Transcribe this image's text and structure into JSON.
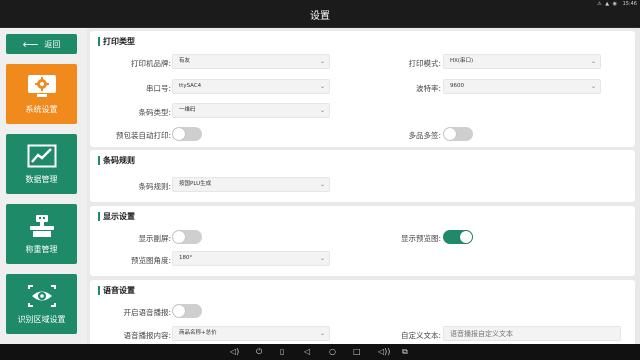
{
  "status_bar": {
    "icons": "⚠ ▲ ◉",
    "time": "15:46"
  },
  "title": "设置",
  "sidebar": {
    "back_label": "返回",
    "items": [
      {
        "label": "系统设置",
        "icon": "gear-icon",
        "active": true
      },
      {
        "label": "数据管理",
        "icon": "line-chart-icon",
        "active": false
      },
      {
        "label": "称重管理",
        "icon": "scale-icon",
        "active": false
      },
      {
        "label": "识别区域设置",
        "icon": "eye-icon",
        "active": false
      }
    ]
  },
  "sections": {
    "print_type": {
      "title": "打印类型",
      "brand_label": "打印机品牌:",
      "brand_value": "有友",
      "mode_label": "打印模式:",
      "mode_value": "HX(串口)",
      "port_label": "串口号:",
      "port_value": "ttySAC4",
      "baud_label": "波特率:",
      "baud_value": "9600",
      "barcode_label": "条码类型:",
      "barcode_value": "一维码",
      "auto_print_label": "预包装自动打印:",
      "auto_print_on": false,
      "multi_label": "多品多签:",
      "multi_on": false
    },
    "barcode_rules": {
      "title": "条码规则",
      "rule_label": "条码规则:",
      "rule_value": "按国PLU生成"
    },
    "display": {
      "title": "显示设置",
      "sub_screen_label": "显示副屏:",
      "sub_screen_on": false,
      "preview_label": "显示预览图:",
      "preview_on": true,
      "angle_label": "预览图角度:",
      "angle_value": "180°"
    },
    "voice": {
      "title": "语音设置",
      "enable_label": "开启语音播报:",
      "enable_on": false,
      "content_label": "语音播报内容:",
      "content_value": "商品名称+总价",
      "custom_label": "自定义文本:",
      "custom_placeholder": "语音播报自定义文本"
    }
  },
  "navbar": {
    "icons": [
      "volume-down-icon",
      "power-icon",
      "back-nav-icon",
      "home-icon",
      "recents-icon",
      "volume-up-icon",
      "screenshot-icon"
    ]
  }
}
